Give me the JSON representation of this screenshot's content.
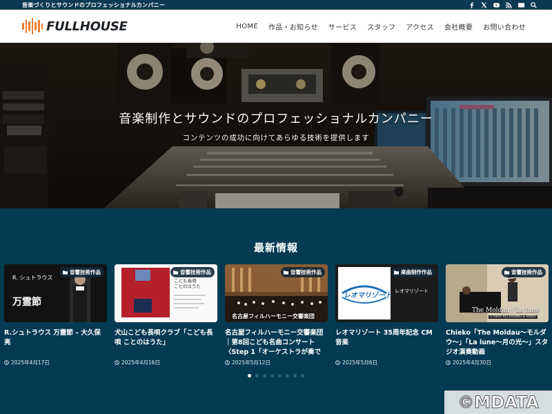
{
  "topbar": {
    "tagline": "音楽づくりとサウンドのプロフェッショナルカンパニー",
    "icons": [
      "facebook-icon",
      "x-icon",
      "youtube-icon",
      "rss-icon",
      "mail-icon",
      "search-icon"
    ]
  },
  "header": {
    "logo_text": "FULLHOUSE",
    "nav": [
      "HOME",
      "作品・お知らせ",
      "サービス",
      "スタッフ",
      "アクセス",
      "会社概要",
      "お問い合わせ"
    ]
  },
  "hero": {
    "title": "音楽制作とサウンドのプロフェッショナルカンパニー",
    "subtitle": "コンテンツの成功に向けてあらゆる技術を提供します"
  },
  "news": {
    "heading": "最新情報",
    "cards": [
      {
        "badge": "音響技術作品",
        "title": "R.シュトラウス 万霊節 – 大久保亮",
        "date": "2025年4月17日",
        "thumb_text": [
          "R. シュトラウス",
          "万霊節"
        ]
      },
      {
        "badge": "音響技術作品",
        "title": "犬山こども長唄クラブ「こども長唄 ことのはうた」",
        "date": "2025年4月16日",
        "thumb_text": [
          "こども長唄",
          "ことのはうた"
        ]
      },
      {
        "badge": "音響技術作品",
        "title": "名古屋フィルハーモニー交響楽団｜第8回こども名曲コンサート〈Step 1「オーケストラが奏で",
        "date": "2025年5月12日",
        "thumb_text": [
          "名古屋フィルハーモニー交響楽団"
        ]
      },
      {
        "badge": "楽曲制作作品",
        "title": "レオマリゾート 35周年記念 CM音楽",
        "date": "2025年5月6日",
        "thumb_text": [
          "レオマリゾート",
          "レオマリゾート"
        ]
      },
      {
        "badge": "音響技術作品",
        "title": "Chieko「The Moldau～モルダウ～」「La lune～月の光～」スタジオ演奏動画",
        "date": "2025年4月30日",
        "thumb_text": [
          "The Moldau / La lune",
          "STUDIO RECORDING & VIDEO"
        ]
      }
    ]
  },
  "carousel": {
    "total": 8,
    "active": 0
  },
  "watermark": "©MDATA",
  "colors": {
    "accent": "#f07a2a",
    "background": "#043a52",
    "topbar": "#0b3a52"
  }
}
